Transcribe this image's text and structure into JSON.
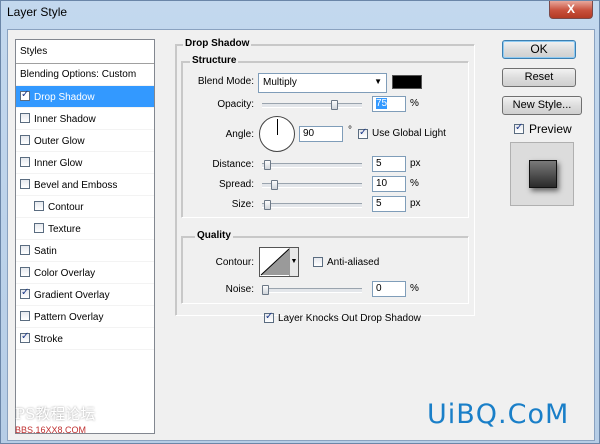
{
  "window": {
    "title": "Layer Style",
    "close_label": "X"
  },
  "styles_panel": {
    "header": "Styles",
    "items": [
      {
        "label": "Blending Options: Custom",
        "checkbox": false,
        "checked": false,
        "selected": false,
        "sub": false
      },
      {
        "label": "Drop Shadow",
        "checkbox": true,
        "checked": true,
        "selected": true,
        "sub": false
      },
      {
        "label": "Inner Shadow",
        "checkbox": true,
        "checked": false,
        "selected": false,
        "sub": false
      },
      {
        "label": "Outer Glow",
        "checkbox": true,
        "checked": false,
        "selected": false,
        "sub": false
      },
      {
        "label": "Inner Glow",
        "checkbox": true,
        "checked": false,
        "selected": false,
        "sub": false
      },
      {
        "label": "Bevel and Emboss",
        "checkbox": true,
        "checked": false,
        "selected": false,
        "sub": false
      },
      {
        "label": "Contour",
        "checkbox": true,
        "checked": false,
        "selected": false,
        "sub": true
      },
      {
        "label": "Texture",
        "checkbox": true,
        "checked": false,
        "selected": false,
        "sub": true
      },
      {
        "label": "Satin",
        "checkbox": true,
        "checked": false,
        "selected": false,
        "sub": false
      },
      {
        "label": "Color Overlay",
        "checkbox": true,
        "checked": false,
        "selected": false,
        "sub": false
      },
      {
        "label": "Gradient Overlay",
        "checkbox": true,
        "checked": true,
        "selected": false,
        "sub": false
      },
      {
        "label": "Pattern Overlay",
        "checkbox": true,
        "checked": false,
        "selected": false,
        "sub": false
      },
      {
        "label": "Stroke",
        "checkbox": true,
        "checked": true,
        "selected": false,
        "sub": false
      }
    ]
  },
  "drop_shadow": {
    "section_title": "Drop Shadow",
    "structure": {
      "title": "Structure",
      "blend_mode_label": "Blend Mode:",
      "blend_mode_value": "Multiply",
      "shadow_color": "#000000",
      "opacity_label": "Opacity:",
      "opacity_value": "75",
      "opacity_level": 0.75,
      "percent": "%",
      "angle_label": "Angle:",
      "angle_value": "90",
      "degree": "°",
      "use_global_light_label": "Use Global Light",
      "use_global_light_checked": true,
      "distance_label": "Distance:",
      "distance_value": "5",
      "distance_level": 0.02,
      "spread_label": "Spread:",
      "spread_value": "10",
      "spread_level": 0.1,
      "size_label": "Size:",
      "size_value": "5",
      "size_level": 0.02,
      "px": "px"
    },
    "quality": {
      "title": "Quality",
      "contour_label": "Contour:",
      "anti_aliased_label": "Anti-aliased",
      "anti_aliased_checked": false,
      "noise_label": "Noise:",
      "noise_value": "0",
      "noise_level": 0.0
    },
    "knockout_label": "Layer Knocks Out Drop Shadow",
    "knockout_checked": true
  },
  "buttons": {
    "ok": "OK",
    "reset": "Reset",
    "new_style": "New Style..."
  },
  "preview": {
    "label": "Preview",
    "checked": true
  },
  "watermarks": {
    "line1": "PS教程论坛",
    "line2": "BBS.16XX8.COM",
    "brand": "UiBQ.CoM"
  }
}
